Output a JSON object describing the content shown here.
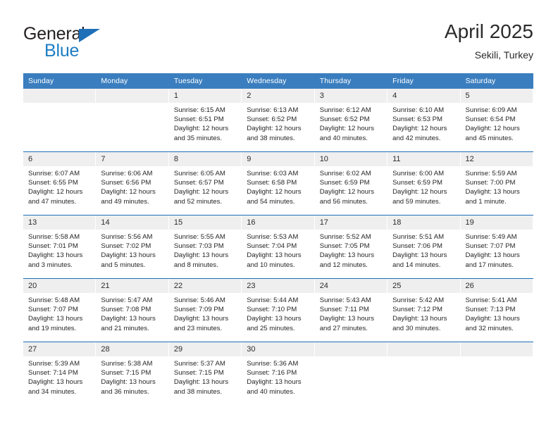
{
  "brand": {
    "name_dark": "General",
    "name_light": "Blue",
    "accent_color": "#1d7dc4",
    "triangle_color": "#1d6fb8"
  },
  "header": {
    "title": "April 2025",
    "subtitle": "Sekili, Turkey"
  },
  "theme": {
    "header_blue": "#3a7ebf",
    "row_line_blue": "#1d6fb8",
    "daynum_band": "#efefef",
    "text": "#262626"
  },
  "weekday_headers": [
    "Sunday",
    "Monday",
    "Tuesday",
    "Wednesday",
    "Thursday",
    "Friday",
    "Saturday"
  ],
  "weeks": [
    [
      {
        "day": "",
        "sunrise": "",
        "sunset": "",
        "daylight": "",
        "empty": true
      },
      {
        "day": "",
        "sunrise": "",
        "sunset": "",
        "daylight": "",
        "empty": true
      },
      {
        "day": "1",
        "sunrise": "Sunrise: 6:15 AM",
        "sunset": "Sunset: 6:51 PM",
        "daylight": "Daylight: 12 hours and 35 minutes."
      },
      {
        "day": "2",
        "sunrise": "Sunrise: 6:13 AM",
        "sunset": "Sunset: 6:52 PM",
        "daylight": "Daylight: 12 hours and 38 minutes."
      },
      {
        "day": "3",
        "sunrise": "Sunrise: 6:12 AM",
        "sunset": "Sunset: 6:52 PM",
        "daylight": "Daylight: 12 hours and 40 minutes."
      },
      {
        "day": "4",
        "sunrise": "Sunrise: 6:10 AM",
        "sunset": "Sunset: 6:53 PM",
        "daylight": "Daylight: 12 hours and 42 minutes."
      },
      {
        "day": "5",
        "sunrise": "Sunrise: 6:09 AM",
        "sunset": "Sunset: 6:54 PM",
        "daylight": "Daylight: 12 hours and 45 minutes."
      }
    ],
    [
      {
        "day": "6",
        "sunrise": "Sunrise: 6:07 AM",
        "sunset": "Sunset: 6:55 PM",
        "daylight": "Daylight: 12 hours and 47 minutes."
      },
      {
        "day": "7",
        "sunrise": "Sunrise: 6:06 AM",
        "sunset": "Sunset: 6:56 PM",
        "daylight": "Daylight: 12 hours and 49 minutes."
      },
      {
        "day": "8",
        "sunrise": "Sunrise: 6:05 AM",
        "sunset": "Sunset: 6:57 PM",
        "daylight": "Daylight: 12 hours and 52 minutes."
      },
      {
        "day": "9",
        "sunrise": "Sunrise: 6:03 AM",
        "sunset": "Sunset: 6:58 PM",
        "daylight": "Daylight: 12 hours and 54 minutes."
      },
      {
        "day": "10",
        "sunrise": "Sunrise: 6:02 AM",
        "sunset": "Sunset: 6:59 PM",
        "daylight": "Daylight: 12 hours and 56 minutes."
      },
      {
        "day": "11",
        "sunrise": "Sunrise: 6:00 AM",
        "sunset": "Sunset: 6:59 PM",
        "daylight": "Daylight: 12 hours and 59 minutes."
      },
      {
        "day": "12",
        "sunrise": "Sunrise: 5:59 AM",
        "sunset": "Sunset: 7:00 PM",
        "daylight": "Daylight: 13 hours and 1 minute."
      }
    ],
    [
      {
        "day": "13",
        "sunrise": "Sunrise: 5:58 AM",
        "sunset": "Sunset: 7:01 PM",
        "daylight": "Daylight: 13 hours and 3 minutes."
      },
      {
        "day": "14",
        "sunrise": "Sunrise: 5:56 AM",
        "sunset": "Sunset: 7:02 PM",
        "daylight": "Daylight: 13 hours and 5 minutes."
      },
      {
        "day": "15",
        "sunrise": "Sunrise: 5:55 AM",
        "sunset": "Sunset: 7:03 PM",
        "daylight": "Daylight: 13 hours and 8 minutes."
      },
      {
        "day": "16",
        "sunrise": "Sunrise: 5:53 AM",
        "sunset": "Sunset: 7:04 PM",
        "daylight": "Daylight: 13 hours and 10 minutes."
      },
      {
        "day": "17",
        "sunrise": "Sunrise: 5:52 AM",
        "sunset": "Sunset: 7:05 PM",
        "daylight": "Daylight: 13 hours and 12 minutes."
      },
      {
        "day": "18",
        "sunrise": "Sunrise: 5:51 AM",
        "sunset": "Sunset: 7:06 PM",
        "daylight": "Daylight: 13 hours and 14 minutes."
      },
      {
        "day": "19",
        "sunrise": "Sunrise: 5:49 AM",
        "sunset": "Sunset: 7:07 PM",
        "daylight": "Daylight: 13 hours and 17 minutes."
      }
    ],
    [
      {
        "day": "20",
        "sunrise": "Sunrise: 5:48 AM",
        "sunset": "Sunset: 7:07 PM",
        "daylight": "Daylight: 13 hours and 19 minutes."
      },
      {
        "day": "21",
        "sunrise": "Sunrise: 5:47 AM",
        "sunset": "Sunset: 7:08 PM",
        "daylight": "Daylight: 13 hours and 21 minutes."
      },
      {
        "day": "22",
        "sunrise": "Sunrise: 5:46 AM",
        "sunset": "Sunset: 7:09 PM",
        "daylight": "Daylight: 13 hours and 23 minutes."
      },
      {
        "day": "23",
        "sunrise": "Sunrise: 5:44 AM",
        "sunset": "Sunset: 7:10 PM",
        "daylight": "Daylight: 13 hours and 25 minutes."
      },
      {
        "day": "24",
        "sunrise": "Sunrise: 5:43 AM",
        "sunset": "Sunset: 7:11 PM",
        "daylight": "Daylight: 13 hours and 27 minutes."
      },
      {
        "day": "25",
        "sunrise": "Sunrise: 5:42 AM",
        "sunset": "Sunset: 7:12 PM",
        "daylight": "Daylight: 13 hours and 30 minutes."
      },
      {
        "day": "26",
        "sunrise": "Sunrise: 5:41 AM",
        "sunset": "Sunset: 7:13 PM",
        "daylight": "Daylight: 13 hours and 32 minutes."
      }
    ],
    [
      {
        "day": "27",
        "sunrise": "Sunrise: 5:39 AM",
        "sunset": "Sunset: 7:14 PM",
        "daylight": "Daylight: 13 hours and 34 minutes."
      },
      {
        "day": "28",
        "sunrise": "Sunrise: 5:38 AM",
        "sunset": "Sunset: 7:15 PM",
        "daylight": "Daylight: 13 hours and 36 minutes."
      },
      {
        "day": "29",
        "sunrise": "Sunrise: 5:37 AM",
        "sunset": "Sunset: 7:15 PM",
        "daylight": "Daylight: 13 hours and 38 minutes."
      },
      {
        "day": "30",
        "sunrise": "Sunrise: 5:36 AM",
        "sunset": "Sunset: 7:16 PM",
        "daylight": "Daylight: 13 hours and 40 minutes."
      },
      {
        "day": "",
        "sunrise": "",
        "sunset": "",
        "daylight": "",
        "empty": true
      },
      {
        "day": "",
        "sunrise": "",
        "sunset": "",
        "daylight": "",
        "empty": true
      },
      {
        "day": "",
        "sunrise": "",
        "sunset": "",
        "daylight": "",
        "empty": true
      }
    ]
  ]
}
